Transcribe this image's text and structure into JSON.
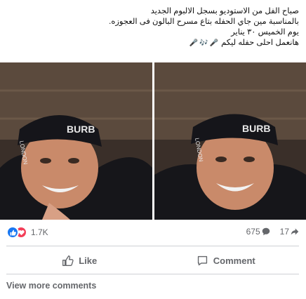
{
  "post": {
    "lines": [
      "صباح الفل من الاستوديو بسجل الالبوم الجديد",
      "بالمناسبة مين جاي الحفله بتاع مسرح البالون فى العجوزه.",
      "يوم الخميس ٣٠ يناير",
      "هانعمل احلى حفله ليكم"
    ]
  },
  "photos": [
    {
      "cap_text": "BURB",
      "side_text": "LONDON"
    },
    {
      "cap_text": "BURB",
      "side_text": "LONDON"
    }
  ],
  "stats": {
    "reaction_count": "1.7K",
    "comments_count": "675",
    "shares_count": "17"
  },
  "actions": {
    "like_label": "Like",
    "comment_label": "Comment"
  },
  "footer": {
    "view_more_label": "View more comments"
  },
  "colors": {
    "like_blue": "#1877f2",
    "love_red": "#f33e58",
    "secondary_text": "#65676b",
    "divider": "#ced0d4"
  },
  "icons": [
    "microphone-icon",
    "music-notes-icon",
    "like-reaction-icon",
    "love-reaction-icon",
    "comment-bubble-icon",
    "share-arrow-icon",
    "thumbs-up-icon",
    "comment-icon"
  ]
}
